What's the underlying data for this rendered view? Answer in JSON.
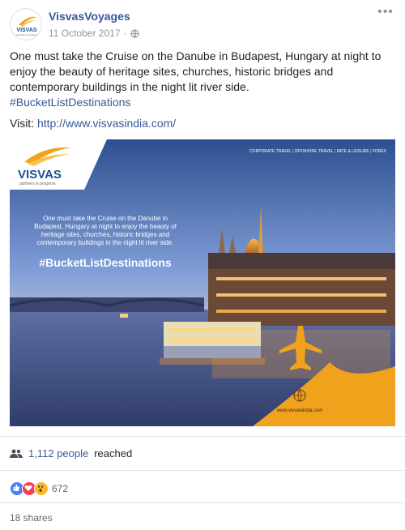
{
  "post": {
    "page_name": "VisvasVoyages",
    "date": "11 October 2017",
    "dot": "·",
    "body_text": "One must take the Cruise on the Danube in Budapest, Hungary at night to enjoy the beauty of heritage sites, churches, historic bridges and contemporary buildings in the night lit river side.",
    "hashtag": "#BucketListDestinations",
    "visit_label": "Visit:",
    "visit_url": "http://www.visvasindia.com/"
  },
  "avatar": {
    "logo_text": "VISVAS",
    "tagline": "partners in progress"
  },
  "ad_image": {
    "logo_text": "VISVAS",
    "logo_tagline": "partners in progress",
    "top_nav": "CORPORATE TRAVEL  |  OFFSHORE TRAVEL  |  MICE & LEISURE  |  FOREX",
    "caption_line1": "One must take the Cruise on the Danube in",
    "caption_line2": "Budapest, Hungary at night to enjoy the beauty of",
    "caption_line3": "heritage sites, churches, historic bridges and",
    "caption_line4": "contemporary buildings in the night lit river side.",
    "caption_hashtag": "#BucketListDestinations",
    "website": "www.visvasindia.com",
    "accent_color": "#f0a21c"
  },
  "stats": {
    "reach_count": "1,112 people",
    "reach_suffix": "reached",
    "reactions_count": "672",
    "shares": "18 shares"
  },
  "colors": {
    "link": "#365899",
    "muted": "#90949c",
    "like_blue": "#4a80f5",
    "love_red": "#f33e58",
    "wow_yellow": "#f7b928"
  }
}
